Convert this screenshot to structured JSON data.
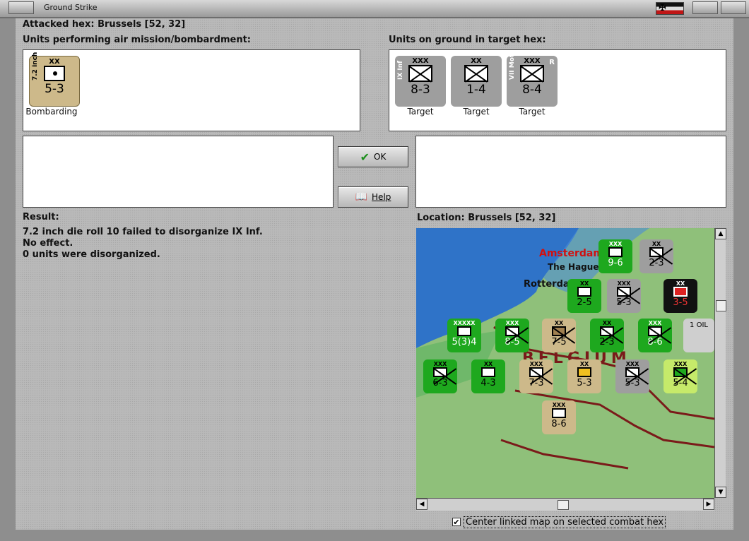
{
  "window": {
    "title": "Ground Strike"
  },
  "header": {
    "attacked_hex": "Attacked hex: Brussels  [52, 32]"
  },
  "air_units": {
    "heading": "Units performing air mission/bombardment:",
    "units": [
      {
        "size": "XX",
        "name": "7.2 inch",
        "strength": "5-3",
        "status": "Bombarding",
        "color": "#cdb98a"
      }
    ]
  },
  "ground_units": {
    "heading": "Units on ground in target hex:",
    "units": [
      {
        "size": "XXX",
        "name": "IX Inf",
        "strength": "8-3",
        "status": "Target",
        "color": "#9e9e9e"
      },
      {
        "size": "XX",
        "name": "",
        "strength": "1-4",
        "status": "Target",
        "color": "#9e9e9e"
      },
      {
        "size": "XXX",
        "name": "VII Mot",
        "strength": "8-4",
        "flag": "R",
        "status": "Target",
        "color": "#9e9e9e"
      }
    ]
  },
  "buttons": {
    "ok": "OK",
    "help": "Help"
  },
  "result": {
    "heading": "Result:",
    "lines": [
      "7.2 inch die roll 10 failed to disorganize IX Inf.",
      "No effect.",
      "0 units were disorganized."
    ]
  },
  "location": {
    "heading": "Location:  Brussels  [52, 32]"
  },
  "map": {
    "places": [
      "Amsterdam",
      "The Hague",
      "Rotterdam",
      "BELGIUM"
    ],
    "counters": [
      "9-6",
      "2-3",
      "5-3",
      "3-5",
      "2-5",
      "8-5",
      "7-5",
      "2-3",
      "8-6",
      "5(3)4",
      "6-3",
      "4-3",
      "7-3",
      "5-3",
      "5-4",
      "8-6",
      "1 OIL"
    ]
  },
  "option": {
    "label": "Center linked map on selected combat hex",
    "checked": true
  },
  "colors": {
    "allied_green": "#1ea81e",
    "german_grey": "#9e9e9e",
    "axis_tan": "#cdb98a",
    "sea_blue": "#2f73c8"
  }
}
